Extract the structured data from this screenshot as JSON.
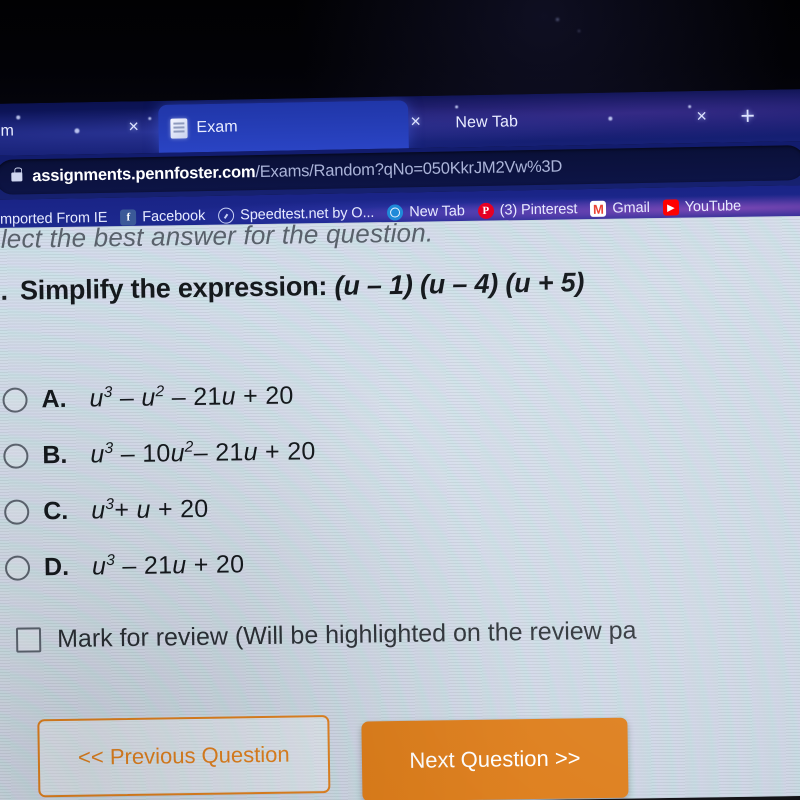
{
  "browser": {
    "tabs": [
      {
        "title": "m",
        "favicon": "none",
        "active": false,
        "truncated": true
      },
      {
        "title": "Exam",
        "favicon": "document-icon",
        "active": true,
        "truncated": false
      },
      {
        "title": "New Tab",
        "favicon": "none",
        "active": false,
        "truncated": false
      }
    ],
    "new_tab_button": "+",
    "close_label": "×",
    "address_bar": {
      "lock": "lock-icon",
      "host": "assignments.pennfoster.com",
      "path": "/Exams/Random?qNo=050KkrJM2Vw%3D",
      "full_url": "assignments.pennfoster.com/Exams/Random?qNo=050KkrJM2Vw%3D"
    },
    "bookmarks": [
      {
        "label": "Imported From IE",
        "icon": "folder-icon"
      },
      {
        "label": "Facebook",
        "icon": "facebook-icon",
        "glyph": "f"
      },
      {
        "label": "Speedtest.net by O...",
        "icon": "speedtest-icon",
        "glyph": ""
      },
      {
        "label": "New Tab",
        "icon": "globe-icon",
        "glyph": ""
      },
      {
        "label": "(3) Pinterest",
        "icon": "pinterest-icon",
        "glyph": "P"
      },
      {
        "label": "Gmail",
        "icon": "gmail-icon",
        "glyph": "M"
      },
      {
        "label": "YouTube",
        "icon": "youtube-icon",
        "glyph": "▶"
      }
    ]
  },
  "exam": {
    "instruction": "elect the best answer for the question.",
    "question_number": "..",
    "question_text": "Simplify the expression: (u – 1) (u – 4) (u + 5)",
    "question_prefix": "Simplify the expression:",
    "question_expression": "(u – 1) (u – 4) (u + 5)",
    "options": [
      {
        "letter": "A.",
        "expression": "u³ – u² – 21u + 20",
        "selected": false
      },
      {
        "letter": "B.",
        "expression": "u³ – 10u²– 21u + 20",
        "selected": false
      },
      {
        "letter": "C.",
        "expression": "u³+ u + 20",
        "selected": false
      },
      {
        "letter": "D.",
        "expression": "u³ – 21u + 20",
        "selected": false
      }
    ],
    "mark_for_review": {
      "label": "Mark for review (Will be highlighted on the review pa",
      "checked": false
    },
    "buttons": {
      "previous": "<< Previous Question",
      "next": "Next Question >>"
    }
  },
  "colors": {
    "accent_orange": "#dd7b16",
    "accent_orange_outline": "#e0811f",
    "chrome_blue": "#1d2a92",
    "tab_active_blue": "#2a44c4",
    "page_bg": "#d6e0ea"
  }
}
